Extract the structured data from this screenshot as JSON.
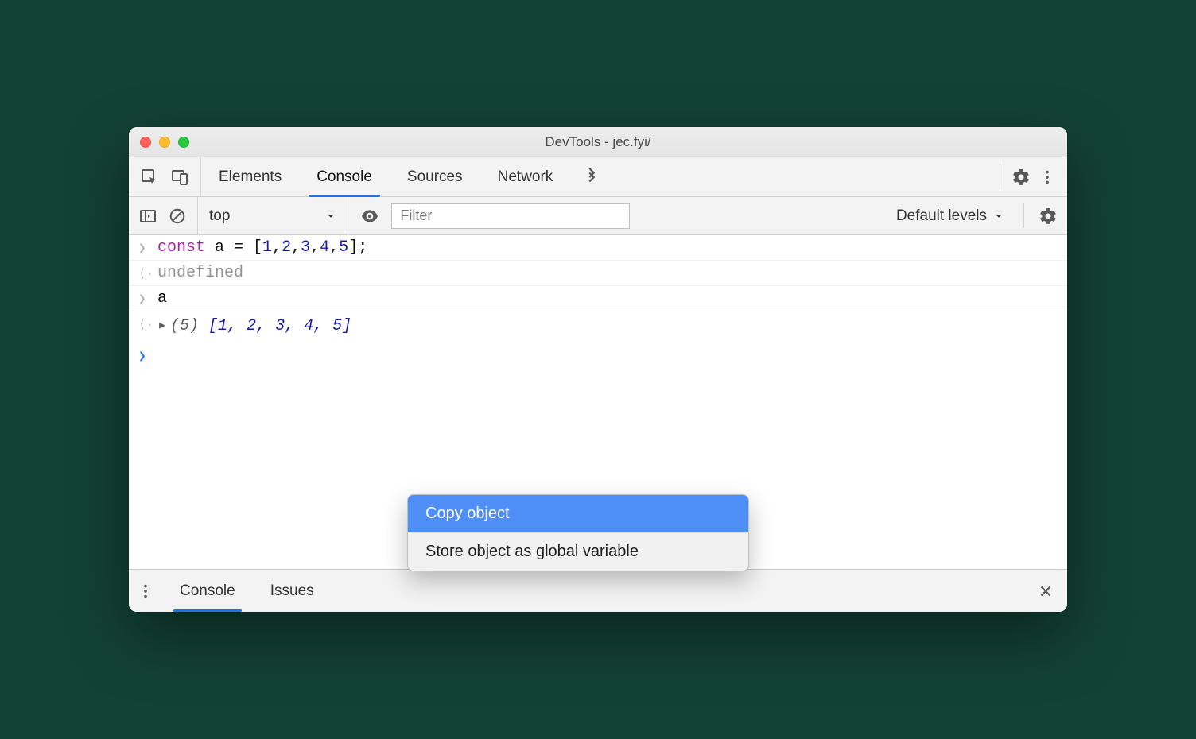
{
  "window": {
    "title": "DevTools - jec.fyi/"
  },
  "tabs": {
    "elements": "Elements",
    "console": "Console",
    "sources": "Sources",
    "network": "Network"
  },
  "subbar": {
    "context": "top",
    "filter_placeholder": "Filter",
    "levels_label": "Default levels"
  },
  "console": {
    "line1": {
      "kw": "const",
      "ident": " a ",
      "eq": "= [",
      "n1": "1",
      "c1": ",",
      "n2": "2",
      "c2": ",",
      "n3": "3",
      "c3": ",",
      "n4": "4",
      "c4": ",",
      "n5": "5",
      "close": "];"
    },
    "line2": "undefined",
    "line3": "a",
    "line4": {
      "count": "(5) ",
      "open": "[",
      "n1": "1",
      "c1": ", ",
      "n2": "2",
      "c2": ", ",
      "n3": "3",
      "c3": ", ",
      "n4": "4",
      "c4": ", ",
      "n5": "5",
      "close": "]"
    }
  },
  "context_menu": {
    "item1": "Copy object",
    "item2": "Store object as global variable"
  },
  "drawer": {
    "console": "Console",
    "issues": "Issues"
  }
}
